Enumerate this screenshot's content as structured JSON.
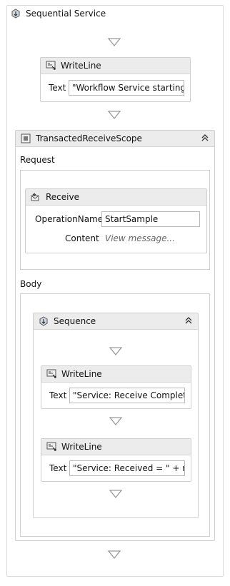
{
  "root": {
    "title": "Sequential Service"
  },
  "writeline1": {
    "title": "WriteLine",
    "text_label": "Text",
    "text_value": "\"Workflow Service starting ...\""
  },
  "scope": {
    "title": "TransactedReceiveScope",
    "request_label": "Request",
    "body_label": "Body",
    "receive": {
      "title": "Receive",
      "operation_label": "OperationName",
      "operation_value": "StartSample",
      "content_label": "Content",
      "content_placeholder": "View message..."
    },
    "sequence": {
      "title": "Sequence",
      "writeline_a": {
        "title": "WriteLine",
        "text_label": "Text",
        "text_value": "\"Service: Receive Completed\""
      },
      "writeline_b": {
        "title": "WriteLine",
        "text_label": "Text",
        "text_value": "\"Service: Received = \" + reque"
      }
    }
  },
  "icons": {
    "root": "sequence-icon",
    "writeline": "writeline-icon",
    "scope": "scope-icon",
    "receive": "receive-icon",
    "collapse": "collapse-chevron-icon",
    "drop": "drop-arrow-icon"
  }
}
